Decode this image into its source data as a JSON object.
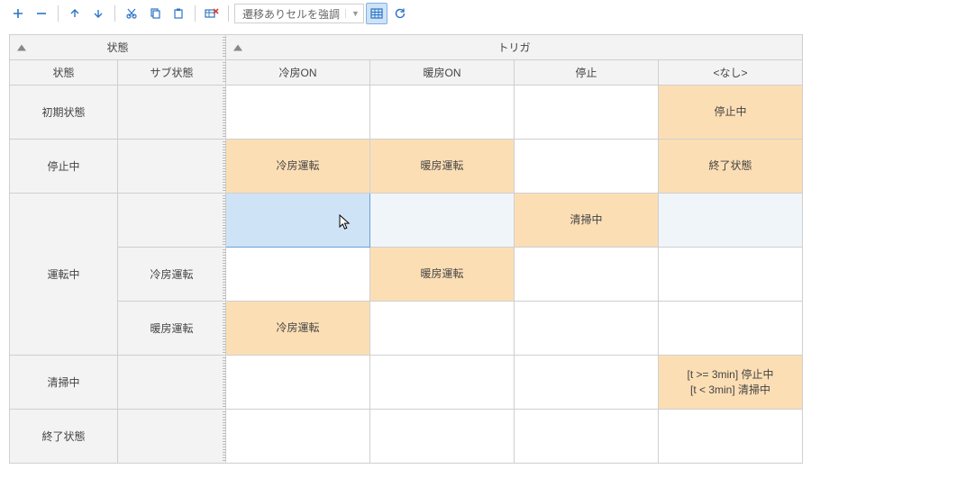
{
  "toolbar": {
    "dropdown_label": "遷移ありセルを強調"
  },
  "headers": {
    "state_group": "状態",
    "trigger_group": "トリガ",
    "state": "状態",
    "substate": "サブ状態",
    "trigger_cool_on": "冷房ON",
    "trigger_heat_on": "暖房ON",
    "trigger_stop": "停止",
    "trigger_none": "<なし>"
  },
  "rows": {
    "initial": {
      "state": "初期状態",
      "none": "停止中"
    },
    "stopped": {
      "state": "停止中",
      "cool_on": "冷房運転",
      "heat_on": "暖房運転",
      "none": "終了状態"
    },
    "running": {
      "state": "運転中",
      "stop": "清掃中"
    },
    "running_cool": {
      "substate": "冷房運転",
      "heat_on": "暖房運転"
    },
    "running_heat": {
      "substate": "暖房運転",
      "cool_on": "冷房運転"
    },
    "cleaning": {
      "state": "清掃中",
      "none": "[t >= 3min] 停止中\n[t < 3min] 清掃中"
    },
    "end": {
      "state": "終了状態"
    }
  }
}
